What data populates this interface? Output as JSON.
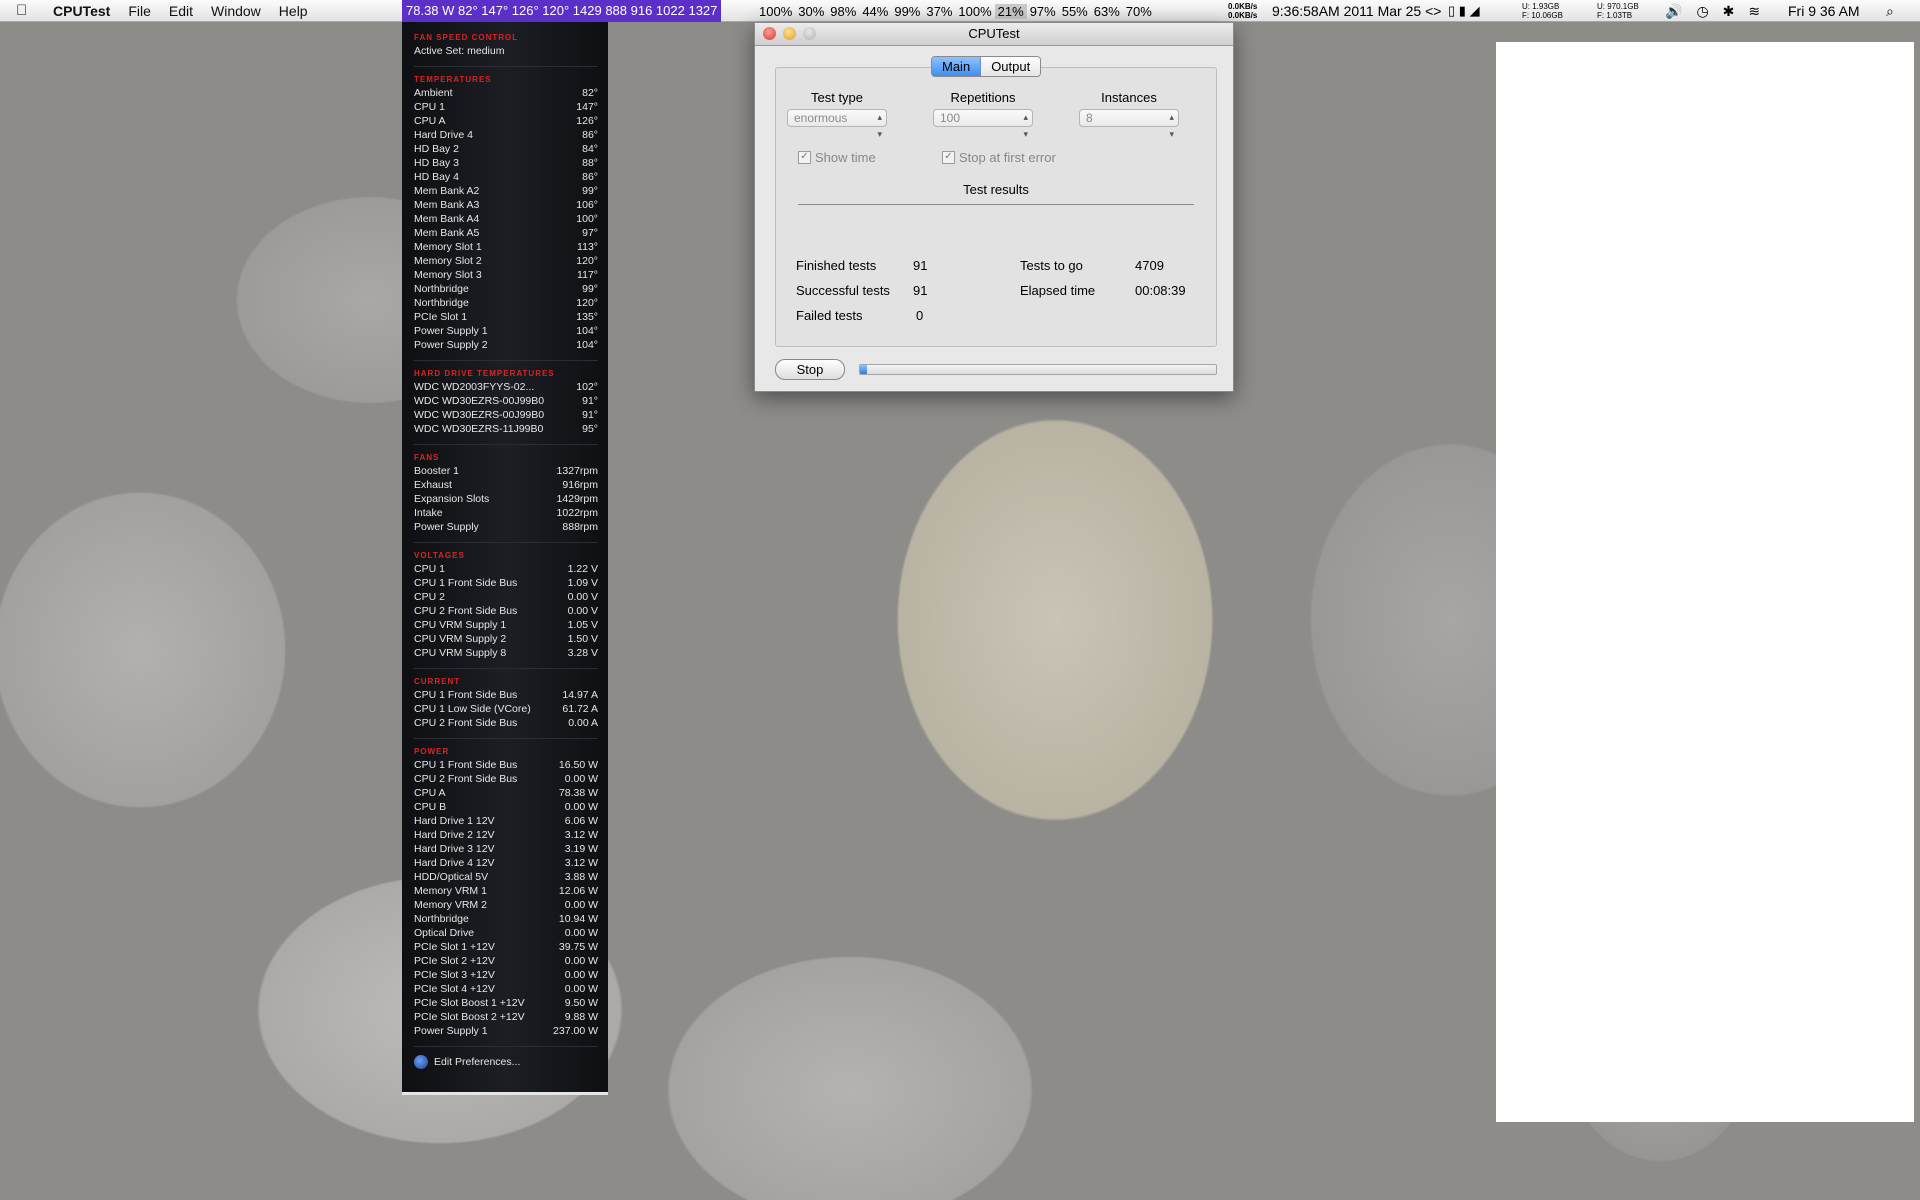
{
  "menubar": {
    "app_name": "CPUTest",
    "menus": [
      "File",
      "Edit",
      "Window",
      "Help"
    ],
    "ticker": "78.38 W 82° 147° 126° 120° 1429 888 916 1022 1327",
    "cpu_usage": [
      "100%",
      "30%",
      "98%",
      "44%",
      "99%",
      "37%",
      "100%",
      "21%",
      "97%",
      "55%",
      "63%",
      "70%"
    ],
    "net_in": "0.0KB/s",
    "net_out": "0.0KB/s",
    "datetime": "9:36:58AM 2011 Mar 25",
    "nav_arrows": "<>",
    "disk1_used": "1.93GB",
    "disk1_free": "10.06GB",
    "disk2_used": "970.1GB",
    "disk2_free": "1.03TB",
    "disk_u_label": "U:",
    "disk_f_label": "F:",
    "day_clock": "Fri 9 36 AM"
  },
  "istat": {
    "fan_speed_title": "FAN SPEED CONTROL",
    "active_set_label": "Active Set:",
    "active_set_value": "medium",
    "temperatures_title": "TEMPERATURES",
    "temperatures": [
      {
        "name": "Ambient",
        "value": "82°"
      },
      {
        "name": "CPU 1",
        "value": "147°"
      },
      {
        "name": "CPU A",
        "value": "126°"
      },
      {
        "name": "Hard Drive 4",
        "value": "86°"
      },
      {
        "name": "HD Bay 2",
        "value": "84°"
      },
      {
        "name": "HD Bay 3",
        "value": "88°"
      },
      {
        "name": "HD Bay 4",
        "value": "86°"
      },
      {
        "name": "Mem Bank A2",
        "value": "99°"
      },
      {
        "name": "Mem Bank A3",
        "value": "106°"
      },
      {
        "name": "Mem Bank A4",
        "value": "100°"
      },
      {
        "name": "Mem Bank A5",
        "value": "97°"
      },
      {
        "name": "Memory Slot 1",
        "value": "113°"
      },
      {
        "name": "Memory Slot 2",
        "value": "120°"
      },
      {
        "name": "Memory Slot 3",
        "value": "117°"
      },
      {
        "name": "Northbridge",
        "value": "99°"
      },
      {
        "name": "Northbridge",
        "value": "120°"
      },
      {
        "name": "PCIe Slot 1",
        "value": "135°"
      },
      {
        "name": "Power Supply 1",
        "value": "104°"
      },
      {
        "name": "Power Supply 2",
        "value": "104°"
      }
    ],
    "hd_temps_title": "HARD DRIVE TEMPERATURES",
    "hd_temps": [
      {
        "name": "WDC WD2003FYYS-02...",
        "value": "102°"
      },
      {
        "name": "WDC WD30EZRS-00J99B0",
        "value": "91°"
      },
      {
        "name": "WDC WD30EZRS-00J99B0",
        "value": "91°"
      },
      {
        "name": "WDC WD30EZRS-11J99B0",
        "value": "95°"
      }
    ],
    "fans_title": "FANS",
    "fans": [
      {
        "name": "Booster 1",
        "value": "1327rpm"
      },
      {
        "name": "Exhaust",
        "value": "916rpm"
      },
      {
        "name": "Expansion Slots",
        "value": "1429rpm"
      },
      {
        "name": "Intake",
        "value": "1022rpm"
      },
      {
        "name": "Power Supply",
        "value": "888rpm"
      }
    ],
    "voltages_title": "VOLTAGES",
    "voltages": [
      {
        "name": "CPU 1",
        "value": "1.22 V"
      },
      {
        "name": "CPU 1 Front Side Bus",
        "value": "1.09 V"
      },
      {
        "name": "CPU 2",
        "value": "0.00 V"
      },
      {
        "name": "CPU 2 Front Side Bus",
        "value": "0.00 V"
      },
      {
        "name": "CPU VRM Supply 1",
        "value": "1.05 V"
      },
      {
        "name": "CPU VRM Supply 2",
        "value": "1.50 V"
      },
      {
        "name": "CPU VRM Supply 8",
        "value": "3.28 V"
      }
    ],
    "current_title": "CURRENT",
    "current": [
      {
        "name": "CPU 1 Front Side Bus",
        "value": "14.97 A"
      },
      {
        "name": "CPU 1 Low Side (VCore)",
        "value": "61.72 A"
      },
      {
        "name": "CPU 2 Front Side Bus",
        "value": "0.00 A"
      }
    ],
    "power_title": "POWER",
    "power": [
      {
        "name": "CPU 1 Front Side Bus",
        "value": "16.50 W"
      },
      {
        "name": "CPU 2 Front Side Bus",
        "value": "0.00 W"
      },
      {
        "name": "CPU A",
        "value": "78.38 W"
      },
      {
        "name": "CPU B",
        "value": "0.00 W"
      },
      {
        "name": "Hard Drive 1 12V",
        "value": "6.06 W"
      },
      {
        "name": "Hard Drive 2 12V",
        "value": "3.12 W"
      },
      {
        "name": "Hard Drive 3 12V",
        "value": "3.19 W"
      },
      {
        "name": "Hard Drive 4 12V",
        "value": "3.12 W"
      },
      {
        "name": "HDD/Optical 5V",
        "value": "3.88 W"
      },
      {
        "name": "Memory VRM 1",
        "value": "12.06 W"
      },
      {
        "name": "Memory VRM 2",
        "value": "0.00 W"
      },
      {
        "name": "Northbridge",
        "value": "10.94 W"
      },
      {
        "name": "Optical Drive",
        "value": "0.00 W"
      },
      {
        "name": "PCIe Slot 1 +12V",
        "value": "39.75 W"
      },
      {
        "name": "PCIe Slot 2 +12V",
        "value": "0.00 W"
      },
      {
        "name": "PCIe Slot 3 +12V",
        "value": "0.00 W"
      },
      {
        "name": "PCIe Slot 4 +12V",
        "value": "0.00 W"
      },
      {
        "name": "PCIe Slot Boost 1 +12V",
        "value": "9.50 W"
      },
      {
        "name": "PCIe Slot Boost 2 +12V",
        "value": "9.88 W"
      },
      {
        "name": "Power Supply 1",
        "value": "237.00 W"
      }
    ],
    "edit_prefs": "Edit Preferences..."
  },
  "window": {
    "title": "CPUTest",
    "tabs": {
      "main": "Main",
      "output": "Output"
    },
    "test_type_label": "Test type",
    "test_type_value": "enormous",
    "repetitions_label": "Repetitions",
    "repetitions_value": "100",
    "instances_label": "Instances",
    "instances_value": "8",
    "show_time_label": "Show time",
    "stop_first_error_label": "Stop at first error",
    "results_title": "Test results",
    "finished_label": "Finished tests",
    "finished_value": "91",
    "successful_label": "Successful tests",
    "successful_value": "91",
    "failed_label": "Failed tests",
    "failed_value": "0",
    "to_go_label": "Tests to go",
    "to_go_value": "4709",
    "elapsed_label": "Elapsed time",
    "elapsed_value": "00:08:39",
    "stop_button": "Stop",
    "progress_fraction": 0.019
  },
  "colors": {
    "ticker_bg": "#5c2fc9",
    "istat_heading": "#d92424",
    "selected_tab": "#3f8ef0"
  }
}
